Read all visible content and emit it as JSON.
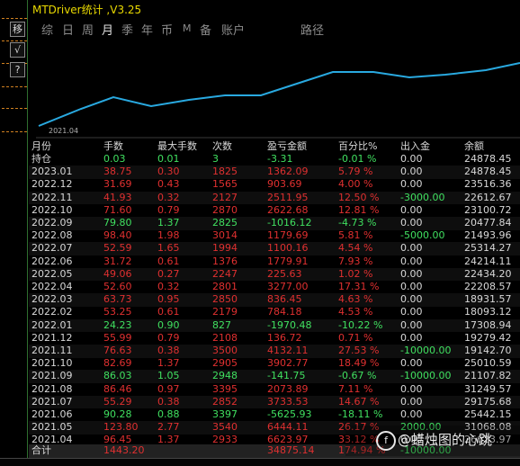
{
  "app": {
    "title": "MTDriver统计 ,V3.25"
  },
  "left_toolbar": {
    "buttons": [
      {
        "label": "移",
        "icon": "move-icon"
      },
      {
        "label": "√",
        "icon": "check-icon"
      },
      {
        "label": "?",
        "icon": "help-icon"
      }
    ]
  },
  "tabs": [
    "综",
    "日",
    "周",
    "月",
    "季",
    "年",
    "币",
    "M",
    "备",
    "账户",
    "路径"
  ],
  "active_tab": "月",
  "chart": {
    "start_date": "2021.04",
    "line_color": "#29a9e0"
  },
  "table": {
    "headers": [
      "月份",
      "手数",
      "最大手数",
      "次数",
      "盈亏金额",
      "百分比%",
      "出入金",
      "余额"
    ],
    "rows": [
      {
        "month": "持仓",
        "lots": "0.03",
        "max": "0.01",
        "count": "3",
        "pnl": "-3.31",
        "pct": "-0.01 %",
        "flow": "0.00",
        "bal": "24878.45",
        "color": "grn"
      },
      {
        "month": "2023.01",
        "lots": "38.75",
        "max": "0.30",
        "count": "1825",
        "pnl": "1362.09",
        "pct": "5.79 %",
        "flow": "0.00",
        "bal": "24878.45",
        "color": "red"
      },
      {
        "month": "2022.12",
        "lots": "31.69",
        "max": "0.43",
        "count": "1565",
        "pnl": "903.69",
        "pct": "4.00 %",
        "flow": "0.00",
        "bal": "23516.36",
        "color": "red"
      },
      {
        "month": "2022.11",
        "lots": "41.93",
        "max": "0.32",
        "count": "2127",
        "pnl": "2511.95",
        "pct": "12.50 %",
        "flow": "-3000.00",
        "bal": "22612.67",
        "color": "red",
        "flow_color": "grn"
      },
      {
        "month": "2022.10",
        "lots": "71.60",
        "max": "0.79",
        "count": "2870",
        "pnl": "2622.68",
        "pct": "12.81 %",
        "flow": "0.00",
        "bal": "23100.72",
        "color": "red"
      },
      {
        "month": "2022.09",
        "lots": "79.80",
        "max": "1.37",
        "count": "2825",
        "pnl": "-1016.12",
        "pct": "-4.73 %",
        "flow": "0.00",
        "bal": "20477.84",
        "color": "grn"
      },
      {
        "month": "2022.08",
        "lots": "98.40",
        "max": "1.98",
        "count": "3014",
        "pnl": "1179.69",
        "pct": "5.81 %",
        "flow": "-5000.00",
        "bal": "21493.96",
        "color": "red",
        "flow_color": "grn"
      },
      {
        "month": "2022.07",
        "lots": "52.59",
        "max": "1.65",
        "count": "1994",
        "pnl": "1100.16",
        "pct": "4.54 %",
        "flow": "0.00",
        "bal": "25314.27",
        "color": "red"
      },
      {
        "month": "2022.06",
        "lots": "31.72",
        "max": "0.61",
        "count": "1376",
        "pnl": "1779.91",
        "pct": "7.93 %",
        "flow": "0.00",
        "bal": "24214.11",
        "color": "red"
      },
      {
        "month": "2022.05",
        "lots": "49.06",
        "max": "0.27",
        "count": "2247",
        "pnl": "225.63",
        "pct": "1.02 %",
        "flow": "0.00",
        "bal": "22434.20",
        "color": "red"
      },
      {
        "month": "2022.04",
        "lots": "52.60",
        "max": "0.32",
        "count": "2801",
        "pnl": "3277.00",
        "pct": "17.31 %",
        "flow": "0.00",
        "bal": "22208.57",
        "color": "red"
      },
      {
        "month": "2022.03",
        "lots": "63.73",
        "max": "0.95",
        "count": "2850",
        "pnl": "836.45",
        "pct": "4.63 %",
        "flow": "0.00",
        "bal": "18931.57",
        "color": "red"
      },
      {
        "month": "2022.02",
        "lots": "53.25",
        "max": "0.61",
        "count": "2179",
        "pnl": "784.18",
        "pct": "4.53 %",
        "flow": "0.00",
        "bal": "18093.12",
        "color": "red"
      },
      {
        "month": "2022.01",
        "lots": "24.23",
        "max": "0.90",
        "count": "827",
        "pnl": "-1970.48",
        "pct": "-10.22 %",
        "flow": "0.00",
        "bal": "17308.94",
        "color": "grn"
      },
      {
        "month": "2021.12",
        "lots": "55.99",
        "max": "0.79",
        "count": "2108",
        "pnl": "136.72",
        "pct": "0.71 %",
        "flow": "0.00",
        "bal": "19279.42",
        "color": "red"
      },
      {
        "month": "2021.11",
        "lots": "76.63",
        "max": "0.38",
        "count": "3500",
        "pnl": "4132.11",
        "pct": "27.53 %",
        "flow": "-10000.00",
        "bal": "19142.70",
        "color": "red",
        "flow_color": "grn"
      },
      {
        "month": "2021.10",
        "lots": "82.69",
        "max": "1.37",
        "count": "2905",
        "pnl": "3902.77",
        "pct": "18.49 %",
        "flow": "0.00",
        "bal": "25010.59",
        "color": "red"
      },
      {
        "month": "2021.09",
        "lots": "86.03",
        "max": "1.05",
        "count": "2948",
        "pnl": "-141.75",
        "pct": "-0.67 %",
        "flow": "-10000.00",
        "bal": "21107.82",
        "color": "grn",
        "flow_color": "grn"
      },
      {
        "month": "2021.08",
        "lots": "86.46",
        "max": "0.97",
        "count": "3395",
        "pnl": "2073.89",
        "pct": "7.11 %",
        "flow": "0.00",
        "bal": "31249.57",
        "color": "red"
      },
      {
        "month": "2021.07",
        "lots": "55.29",
        "max": "0.38",
        "count": "2852",
        "pnl": "3733.53",
        "pct": "14.67 %",
        "flow": "0.00",
        "bal": "29175.68",
        "color": "red"
      },
      {
        "month": "2021.06",
        "lots": "90.28",
        "max": "0.88",
        "count": "3397",
        "pnl": "-5625.93",
        "pct": "-18.11 %",
        "flow": "0.00",
        "bal": "25442.15",
        "color": "grn"
      },
      {
        "month": "2021.05",
        "lots": "123.80",
        "max": "2.77",
        "count": "3540",
        "pnl": "6444.11",
        "pct": "26.17 %",
        "flow": "2000.00",
        "bal": "31068.08",
        "color": "red",
        "flow_color": "grn"
      },
      {
        "month": "2021.04",
        "lots": "96.45",
        "max": "1.37",
        "count": "2933",
        "pnl": "6623.97",
        "pct": "33.12 %",
        "flow": "0.00",
        "bal": "26623.97",
        "color": "red"
      }
    ],
    "total": {
      "month": "合计",
      "lots": "1443.20",
      "pnl": "34875.14",
      "pct": "174.94 %",
      "flow": "-10000.00"
    }
  },
  "watermark": {
    "text": "@蜡烛图的心跳",
    "logo": "f"
  }
}
